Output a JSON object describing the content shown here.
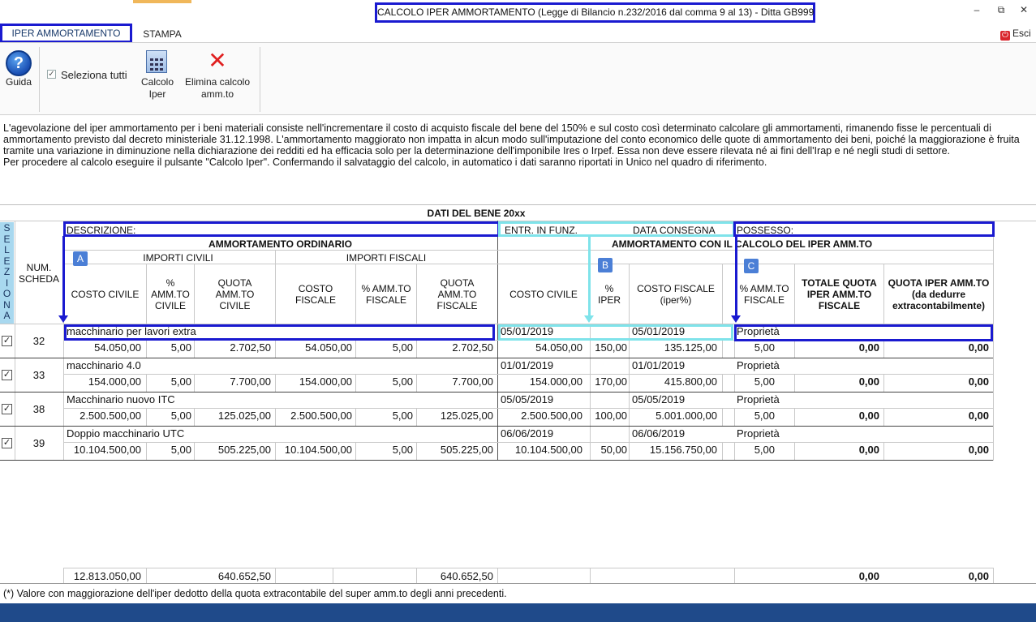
{
  "window": {
    "title": "CALCOLO IPER AMMORTAMENTO (Legge di Bilancio n.232/2016 dal comma 9 al 13) - Ditta GB999",
    "minimize": "–",
    "restore": "⧉",
    "close": "✕"
  },
  "tabs": {
    "iper": "IPER AMMORTAMENTO",
    "stampa": "STAMPA",
    "esci": "Esci"
  },
  "ribbon": {
    "guida": "Guida",
    "seleziona_tutti": "Seleziona tutti",
    "calcolo_line1": "Calcolo",
    "calcolo_line2": "Iper",
    "elimina_line1": "Elimina calcolo",
    "elimina_line2": "amm.to"
  },
  "description": [
    "L'agevolazione del iper ammortamento per i beni materiali consiste nell'incrementare il costo di acquisto fiscale del bene del 150% e sul costo così determinato calcolare gli ammortamenti, rimanendo fisse le percentuali di ammortamento previsto dal decreto ministeriale 31.12.1998. L'ammortamento maggiorato non impatta in alcun modo sull'imputazione del conto economico delle quote di ammortamento dei beni, poiché la maggiorazione è fruita tramite una variazione in diminuzione nella dichiarazione dei redditi ed ha efficacia solo per la determinazione dell'imponibile Ires o Irpef. Essa non deve essere rilevata né ai fini dell'Irap e né negli studi di settore.",
    "Per procedere al calcolo eseguire il pulsante \"Calcolo Iper\". Confermando il salvataggio del calcolo, in automatico i dati saranno riportati in Unico nel quadro di riferimento."
  ],
  "grid": {
    "title": "DATI DEL BENE 20xx",
    "seleziona": "SELEZIONA",
    "num_scheda": "NUM. SCHEDA",
    "descrizione": "DESCRIZIONE:",
    "entr_in_funz": "ENTR. IN FUNZ.",
    "data_consegna": "DATA CONSEGNA",
    "possesso": "POSSESSO:",
    "amm_ordinario": "AMMORTAMENTO ORDINARIO",
    "amm_iper": "AMMORTAMENTO CON IL CALCOLO DEL IPER AMM.TO",
    "importi_civili": "IMPORTI CIVILI",
    "importi_fiscali": "IMPORTI FISCALI",
    "badge_a": "A",
    "badge_b": "B",
    "badge_c": "C",
    "columns": {
      "costo_civile": "COSTO CIVILE",
      "amm_civile": "% AMM.TO CIVILE",
      "quota_civile": "QUOTA AMM.TO CIVILE",
      "costo_fiscale": "COSTO FISCALE",
      "amm_fiscale": "% AMM.TO FISCALE",
      "quota_fiscale": "QUOTA AMM.TO FISCALE",
      "iper_costo_civile": "COSTO CIVILE",
      "iper_pct": "% IPER",
      "iper_costo_fiscale": "COSTO FISCALE (iper%)",
      "iper_amm_fiscale": "% AMM.TO FISCALE",
      "totale_quota": "TOTALE QUOTA IPER AMM.TO FISCALE",
      "quota_iper": "QUOTA IPER AMM.TO (da dedurre extracontabilmente)"
    },
    "rows": [
      {
        "checked": "✓",
        "scheda": "32",
        "descrizione": "macchinario per lavori extra",
        "entr_funz": "05/01/2019",
        "data_consegna": "05/01/2019",
        "possesso": "Proprietà",
        "costo_civile": "54.050,00",
        "amm_civile": "5,00",
        "quota_civile": "2.702,50",
        "costo_fiscale": "54.050,00",
        "amm_fiscale": "5,00",
        "quota_fiscale": "2.702,50",
        "iper_costo_civile": "54.050,00",
        "iper_pct": "150,00",
        "iper_costo_fiscale": "135.125,00",
        "iper_amm_fiscale": "5,00",
        "totale_quota": "0,00",
        "quota_iper": "0,00"
      },
      {
        "checked": "✓",
        "scheda": "33",
        "descrizione": "macchinario 4.0",
        "entr_funz": "01/01/2019",
        "data_consegna": "01/01/2019",
        "possesso": "Proprietà",
        "costo_civile": "154.000,00",
        "amm_civile": "5,00",
        "quota_civile": "7.700,00",
        "costo_fiscale": "154.000,00",
        "amm_fiscale": "5,00",
        "quota_fiscale": "7.700,00",
        "iper_costo_civile": "154.000,00",
        "iper_pct": "170,00",
        "iper_costo_fiscale": "415.800,00",
        "iper_amm_fiscale": "5,00",
        "totale_quota": "0,00",
        "quota_iper": "0,00"
      },
      {
        "checked": "✓",
        "scheda": "38",
        "descrizione": "Macchinario nuovo ITC",
        "entr_funz": "05/05/2019",
        "data_consegna": "05/05/2019",
        "possesso": "Proprietà",
        "costo_civile": "2.500.500,00",
        "amm_civile": "5,00",
        "quota_civile": "125.025,00",
        "costo_fiscale": "2.500.500,00",
        "amm_fiscale": "5,00",
        "quota_fiscale": "125.025,00",
        "iper_costo_civile": "2.500.500,00",
        "iper_pct": "100,00",
        "iper_costo_fiscale": "5.001.000,00",
        "iper_amm_fiscale": "5,00",
        "totale_quota": "0,00",
        "quota_iper": "0,00"
      },
      {
        "checked": "✓",
        "scheda": "39",
        "descrizione": "Doppio macchinario UTC",
        "entr_funz": "06/06/2019",
        "data_consegna": "06/06/2019",
        "possesso": "Proprietà",
        "costo_civile": "10.104.500,00",
        "amm_civile": "5,00",
        "quota_civile": "505.225,00",
        "costo_fiscale": "10.104.500,00",
        "amm_fiscale": "5,00",
        "quota_fiscale": "505.225,00",
        "iper_costo_civile": "10.104.500,00",
        "iper_pct": "50,00",
        "iper_costo_fiscale": "15.156.750,00",
        "iper_amm_fiscale": "5,00",
        "totale_quota": "0,00",
        "quota_iper": "0,00"
      }
    ],
    "totals": {
      "costo_civile": "12.813.050,00",
      "quota_civile": "640.652,50",
      "quota_fiscale": "640.652,50",
      "totale_quota": "0,00",
      "quota_iper": "0,00"
    }
  },
  "footer_note": "(*) Valore con maggiorazione dell'iper dedotto della quota extracontabile del super amm.to degli anni precedenti."
}
